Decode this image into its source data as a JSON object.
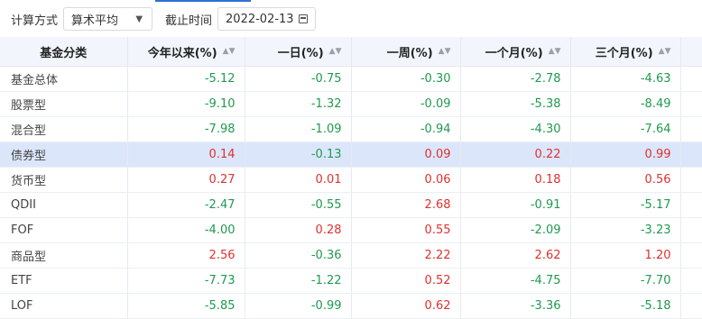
{
  "filters": {
    "calc_label": "计算方式",
    "calc_value": "算术平均",
    "date_label": "截止时间",
    "date_value": "2022-02-13"
  },
  "table": {
    "headers": [
      "基金分类",
      "今年以来(%)",
      "一日(%)",
      "一周(%)",
      "一个月(%)",
      "三个月(%)"
    ],
    "rows": [
      {
        "name": "基金总体",
        "values": [
          "-5.12",
          "-0.75",
          "-0.30",
          "-2.78",
          "-4.63"
        ]
      },
      {
        "name": "股票型",
        "values": [
          "-9.10",
          "-1.32",
          "-0.09",
          "-5.38",
          "-8.49"
        ]
      },
      {
        "name": "混合型",
        "values": [
          "-7.98",
          "-1.09",
          "-0.94",
          "-4.30",
          "-7.64"
        ]
      },
      {
        "name": "债券型",
        "values": [
          "0.14",
          "-0.13",
          "0.09",
          "0.22",
          "0.99"
        ]
      },
      {
        "name": "货币型",
        "values": [
          "0.27",
          "0.01",
          "0.06",
          "0.18",
          "0.56"
        ]
      },
      {
        "name": "QDII",
        "values": [
          "-2.47",
          "-0.55",
          "2.68",
          "-0.91",
          "-5.17"
        ]
      },
      {
        "name": "FOF",
        "values": [
          "-4.00",
          "0.28",
          "0.55",
          "-2.09",
          "-3.23"
        ]
      },
      {
        "name": "商品型",
        "values": [
          "2.56",
          "-0.36",
          "2.22",
          "2.62",
          "1.20"
        ]
      },
      {
        "name": "ETF",
        "values": [
          "-7.73",
          "-1.22",
          "0.52",
          "-4.75",
          "-7.70"
        ]
      },
      {
        "name": "LOF",
        "values": [
          "-5.85",
          "-0.99",
          "0.62",
          "-3.36",
          "-5.18"
        ]
      }
    ],
    "highlight_row": 3
  },
  "colors": {
    "positive": "#e0312f",
    "negative": "#1f9a4f",
    "highlight": "#dbe6fb",
    "header_bg": "#f2f6fc"
  }
}
